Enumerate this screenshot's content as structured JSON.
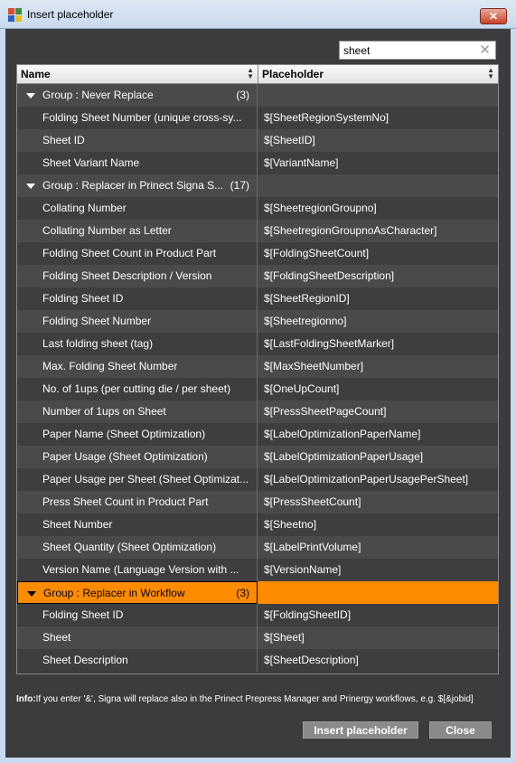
{
  "window": {
    "title": "Insert placeholder",
    "close_glyph": "✕",
    "app_icon": "app-icon"
  },
  "search": {
    "value": "sheet",
    "clear_glyph": "✕"
  },
  "table": {
    "col_name": "Name",
    "col_placeholder": "Placeholder",
    "rows": [
      {
        "type": "group",
        "name": "Group : Never Replace",
        "count": "(3)",
        "placeholder": ""
      },
      {
        "type": "item",
        "name": "Folding Sheet Number (unique cross-sy...",
        "placeholder": "$[SheetRegionSystemNo]"
      },
      {
        "type": "item",
        "name": "Sheet ID",
        "placeholder": "$[SheetID]"
      },
      {
        "type": "item",
        "name": "Sheet Variant Name",
        "placeholder": "$[VariantName]"
      },
      {
        "type": "group",
        "name": "Group : Replacer in Prinect Signa S...",
        "count": "(17)",
        "placeholder": ""
      },
      {
        "type": "item",
        "name": "Collating Number",
        "placeholder": "$[SheetregionGroupno]"
      },
      {
        "type": "item",
        "name": "Collating Number as Letter",
        "placeholder": "$[SheetregionGroupnoAsCharacter]"
      },
      {
        "type": "item",
        "name": "Folding Sheet Count in Product Part",
        "placeholder": "$[FoldingSheetCount]"
      },
      {
        "type": "item",
        "name": "Folding Sheet Description / Version",
        "placeholder": "$[FoldingSheetDescription]"
      },
      {
        "type": "item",
        "name": "Folding Sheet ID",
        "placeholder": "$[SheetRegionID]"
      },
      {
        "type": "item",
        "name": "Folding Sheet Number",
        "placeholder": "$[Sheetregionno]"
      },
      {
        "type": "item",
        "name": "Last folding sheet (tag)",
        "placeholder": "$[LastFoldingSheetMarker]"
      },
      {
        "type": "item",
        "name": "Max. Folding Sheet Number",
        "placeholder": "$[MaxSheetNumber]"
      },
      {
        "type": "item",
        "name": "No. of 1ups (per cutting die / per sheet)",
        "placeholder": "$[OneUpCount]"
      },
      {
        "type": "item",
        "name": "Number of 1ups on Sheet",
        "placeholder": "$[PressSheetPageCount]"
      },
      {
        "type": "item",
        "name": "Paper Name (Sheet Optimization)",
        "placeholder": "$[LabelOptimizationPaperName]"
      },
      {
        "type": "item",
        "name": "Paper Usage (Sheet Optimization)",
        "placeholder": "$[LabelOptimizationPaperUsage]"
      },
      {
        "type": "item",
        "name": "Paper Usage per Sheet (Sheet Optimizat...",
        "placeholder": "$[LabelOptimizationPaperUsagePerSheet]"
      },
      {
        "type": "item",
        "name": "Press Sheet Count in Product Part",
        "placeholder": "$[PressSheetCount]"
      },
      {
        "type": "item",
        "name": "Sheet Number",
        "placeholder": "$[Sheetno]"
      },
      {
        "type": "item",
        "name": "Sheet Quantity (Sheet Optimization)",
        "placeholder": "$[LabelPrintVolume]"
      },
      {
        "type": "item",
        "name": "Version Name (Language Version with ...",
        "placeholder": "$[VersionName]"
      },
      {
        "type": "group",
        "name": "Group : Replacer in Workflow",
        "count": "(3)",
        "placeholder": "",
        "selected": true
      },
      {
        "type": "item",
        "name": "Folding Sheet ID",
        "placeholder": "$[FoldingSheetID]"
      },
      {
        "type": "item",
        "name": "Sheet",
        "placeholder": "$[Sheet]"
      },
      {
        "type": "item",
        "name": "Sheet Description",
        "placeholder": "$[SheetDescription]"
      }
    ]
  },
  "info": {
    "label": "Info:",
    "text": "If you enter '&', Signa will replace also in the Prinect Prepress Manager and Prinergy workflows, e.g. $[&jobid]"
  },
  "buttons": {
    "insert": "Insert placeholder",
    "close": "Close"
  },
  "colors": {
    "selected_row": "#ff8c00",
    "background": "#3c3c3e",
    "button": "#8a8a8a"
  }
}
